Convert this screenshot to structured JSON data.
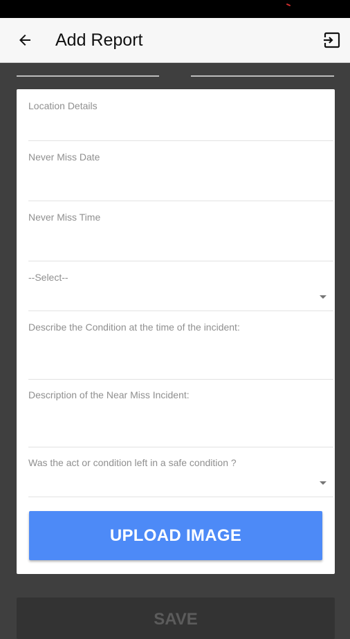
{
  "app_bar": {
    "title": "Add Report",
    "back_icon": "arrow-left-icon",
    "logout_icon": "exit-icon"
  },
  "form": {
    "location_details": {
      "label": "Location Details",
      "value": ""
    },
    "never_miss_date": {
      "label": "Never Miss Date",
      "value": ""
    },
    "never_miss_time": {
      "label": "Never Miss Time",
      "value": ""
    },
    "select_dropdown": {
      "label": "--Select--",
      "value": ""
    },
    "condition_at_incident": {
      "label": "Describe the Condition at the time of the incident:",
      "value": ""
    },
    "incident_description": {
      "label": "Description of the Near Miss Incident:",
      "value": ""
    },
    "safe_condition": {
      "label": "Was the act or condition left in a safe condition ?",
      "value": ""
    }
  },
  "buttons": {
    "upload_image": "UPLOAD IMAGE",
    "save": "SAVE"
  },
  "colors": {
    "background": "#3f3f3f",
    "app_bar": "#f7f7f7",
    "upload_button": "#4d8af7",
    "save_button": "#333333"
  }
}
